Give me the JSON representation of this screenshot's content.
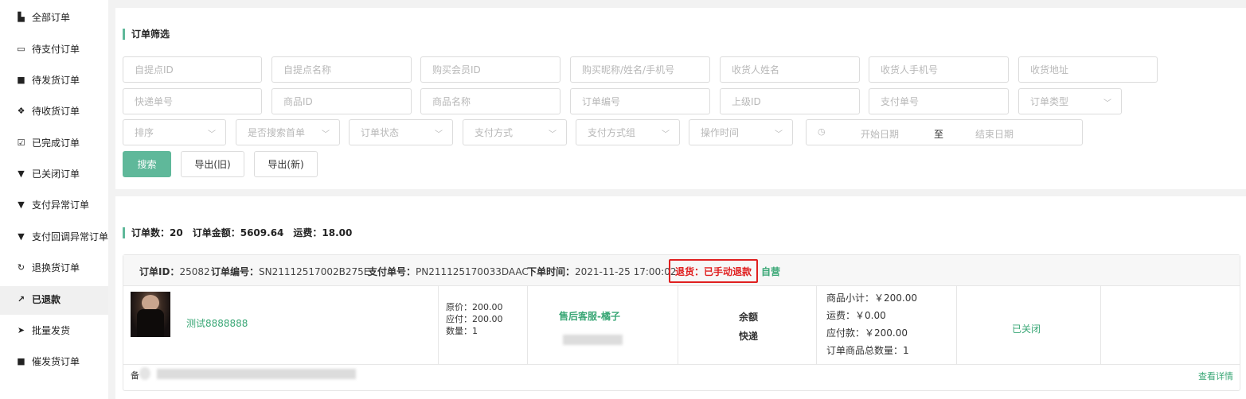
{
  "sidebar": {
    "items": [
      {
        "label": "全部订单",
        "icon": "file-icon",
        "glyph": "▙"
      },
      {
        "label": "待支付订单",
        "icon": "credit-card-icon",
        "glyph": "▭"
      },
      {
        "label": "待发货订单",
        "icon": "truck-icon",
        "glyph": "■"
      },
      {
        "label": "待收货订单",
        "icon": "box-icon",
        "glyph": "❖"
      },
      {
        "label": "已完成订单",
        "icon": "check-square-icon",
        "glyph": "☑"
      },
      {
        "label": "已关闭订单",
        "icon": "trash-icon",
        "glyph": "▼"
      },
      {
        "label": "支付异常订单",
        "icon": "trash-icon",
        "glyph": "▼"
      },
      {
        "label": "支付回调异常订单",
        "icon": "trash-icon",
        "glyph": "▼"
      },
      {
        "label": "退换货订单",
        "icon": "refresh-icon",
        "glyph": "↻"
      },
      {
        "label": "已退款",
        "icon": "share-icon",
        "glyph": "↗"
      },
      {
        "label": "批量发货",
        "icon": "send-icon",
        "glyph": "➤"
      },
      {
        "label": "催发货订单",
        "icon": "truck-icon",
        "glyph": "■"
      }
    ]
  },
  "filter": {
    "title": "订单筛选",
    "row1": [
      "自提点ID",
      "自提点名称",
      "购买会员ID",
      "购买昵称/姓名/手机号",
      "收货人姓名",
      "收货人手机号",
      "收货地址"
    ],
    "row2": [
      "快递单号",
      "商品ID",
      "商品名称",
      "订单编号",
      "上级ID",
      "支付单号",
      "订单类型"
    ],
    "row3": [
      "排序",
      "是否搜索首单",
      "订单状态",
      "支付方式",
      "支付方式组",
      "操作时间"
    ],
    "date": {
      "start": "开始日期",
      "sep": "至",
      "end": "结束日期"
    },
    "buttons": {
      "search": "搜索",
      "export_old": "导出(旧)",
      "export_new": "导出(新)"
    }
  },
  "summary": {
    "count_label": "订单数：",
    "count": "20",
    "amount_label": "订单金额：",
    "amount": "5609.64",
    "freight_label": "运费：",
    "freight": "18.00"
  },
  "order": {
    "id_label": "订单ID：",
    "id": "25082",
    "no_label": "订单编号：",
    "no": "SN21112517002B275E",
    "pay_label": "支付单号：",
    "pay_no": "PN211125170033DAAC",
    "time_label": "下单时间：",
    "time": "2021-11-25 17:00:02",
    "status": "退货：已手动退款",
    "shop_type": "自营",
    "product_name": "测试8888888",
    "price_original": "原价：200.00",
    "price_due": "应付：200.00",
    "quantity": "数量：1",
    "service": "售后客服-橘子",
    "payment": "余额",
    "delivery": "快递",
    "subtotal": "商品小计：￥200.00",
    "freight": "运费：￥0.00",
    "payable": "应付款：￥200.00",
    "total_qty": "订单商品总数量：1",
    "order_status": "已关闭",
    "remark_prefix": "备",
    "detail_link": "查看详情"
  }
}
